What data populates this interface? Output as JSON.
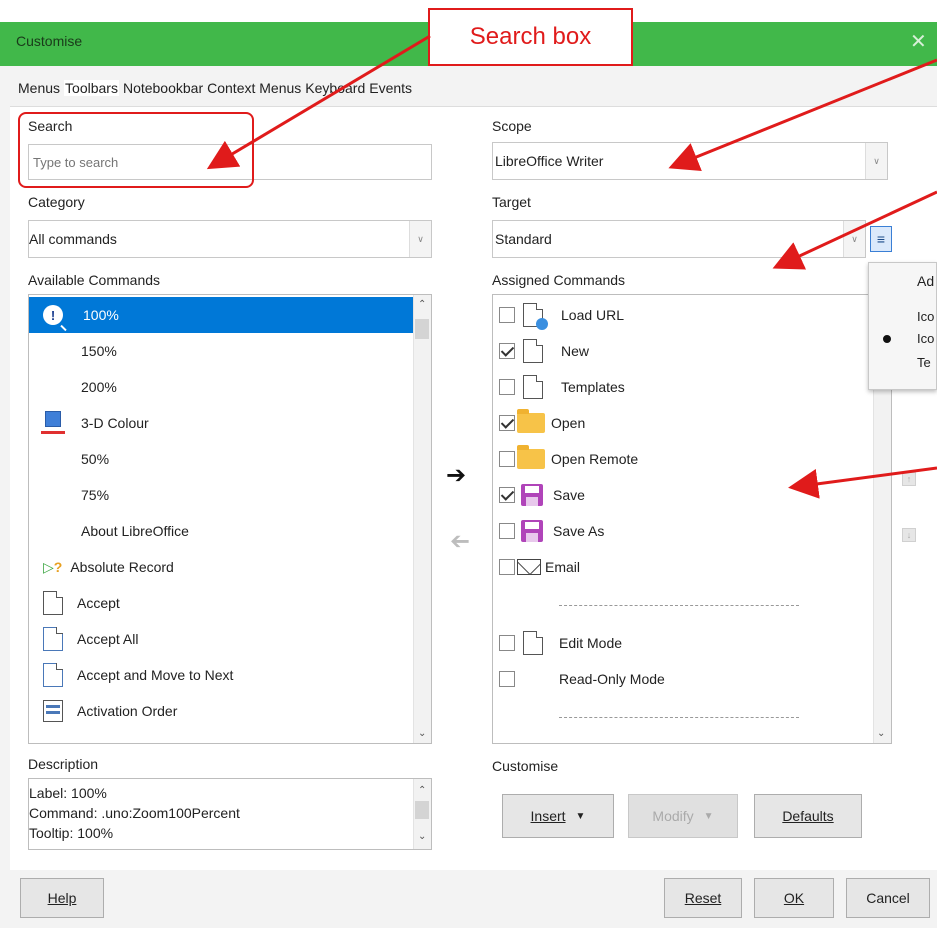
{
  "window": {
    "title": "Customise",
    "close_glyph": "✕"
  },
  "annotation": {
    "callout_text": "Search box"
  },
  "tabs": [
    {
      "label": "Menus"
    },
    {
      "label": "Toolbars",
      "active": true
    },
    {
      "label": "Notebookbar"
    },
    {
      "label": "Context Menus"
    },
    {
      "label": "Keyboard"
    },
    {
      "label": "Events"
    }
  ],
  "left": {
    "search_label": "Search",
    "search_placeholder": "Type to search",
    "category_label": "Category",
    "category_value": "All commands",
    "available_label": "Available Commands",
    "available_items": [
      {
        "label": "100%",
        "icon": "zoom-info-icon",
        "selected": true
      },
      {
        "label": "150%",
        "icon": ""
      },
      {
        "label": "200%",
        "icon": ""
      },
      {
        "label": "3-D Colour",
        "icon": "cube-color-icon"
      },
      {
        "label": "50%",
        "icon": ""
      },
      {
        "label": "75%",
        "icon": ""
      },
      {
        "label": "About LibreOffice",
        "icon": ""
      },
      {
        "label": "Absolute Record",
        "icon": "record-play-icon"
      },
      {
        "label": "Accept",
        "icon": "accept-doc-icon"
      },
      {
        "label": "Accept All",
        "icon": "accept-all-icon"
      },
      {
        "label": "Accept and Move to Next",
        "icon": "accept-next-icon"
      },
      {
        "label": "Activation Order",
        "icon": "activation-order-icon"
      }
    ],
    "description_label": "Description",
    "description_lines": [
      "Label: 100%",
      "Command: .uno:Zoom100Percent",
      "Tooltip: 100%"
    ]
  },
  "right": {
    "scope_label": "Scope",
    "scope_value": "LibreOffice Writer",
    "target_label": "Target",
    "target_value": "Standard",
    "assigned_label": "Assigned Commands",
    "assigned_items": [
      {
        "label": "Load URL",
        "checked": false,
        "icon": "load-url-icon"
      },
      {
        "label": "New",
        "checked": true,
        "icon": "new-doc-icon"
      },
      {
        "label": "Templates",
        "checked": false,
        "icon": "templates-icon"
      },
      {
        "label": "Open",
        "checked": true,
        "icon": "folder-icon"
      },
      {
        "label": "Open Remote",
        "checked": false,
        "icon": "folder-remote-icon"
      },
      {
        "label": "Save",
        "checked": true,
        "icon": "save-icon"
      },
      {
        "label": "Save As",
        "checked": false,
        "icon": "save-as-icon"
      },
      {
        "label": "Email",
        "checked": false,
        "icon": "mail-icon"
      },
      {
        "label": "",
        "separator": true
      },
      {
        "label": "Edit Mode",
        "checked": false,
        "icon": "edit-mode-icon"
      },
      {
        "label": "Read-Only Mode",
        "checked": false,
        "icon": ""
      },
      {
        "label": "",
        "separator": true
      }
    ],
    "menu_popup_items": [
      "Ad",
      "Ico",
      "Ico",
      "Te"
    ],
    "customise_label": "Customise",
    "insert_label": "Insert",
    "modify_label": "Modify",
    "defaults_label": "Defaults"
  },
  "footer": {
    "help": "Help",
    "reset": "Reset",
    "ok": "OK",
    "cancel": "Cancel"
  },
  "colors": {
    "titlebar": "#41b84a",
    "selection": "#0078d7",
    "annotation": "#e01b1b"
  }
}
